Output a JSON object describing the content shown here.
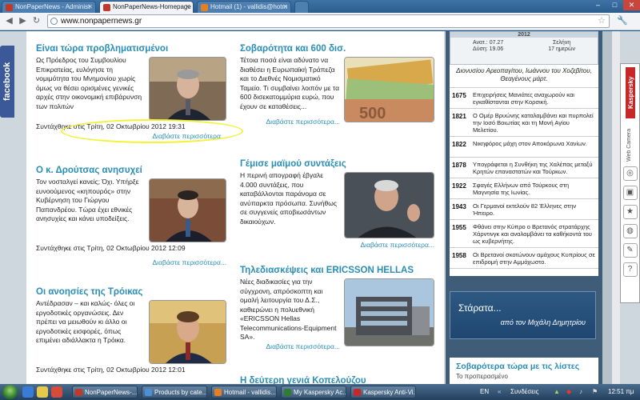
{
  "browser": {
    "tabs": [
      {
        "label": "NonPaperNews - Administ",
        "active": false,
        "favicon_color": "#c0392b"
      },
      {
        "label": "NonPaperNews-Homepage",
        "active": true,
        "favicon_color": "#c0392b"
      },
      {
        "label": "Hotmail (1) - vallidis@hotm",
        "active": false,
        "favicon_color": "#e67e22"
      }
    ],
    "url": "www.nonpapernews.gr",
    "window_controls": [
      "–",
      "□",
      "✕"
    ]
  },
  "facebook_tab": "facebook",
  "articles": [
    {
      "title": "Είναι τώρα προβληματισμένοι",
      "body": "Ως Πρόεδρος του Συμβουλίου Επικρατείας, ευλόγησε τη νομιμότητα του Μνημονίου χωρίς όμως να θέσει ορισμένες γενικές αρχές στην οικονομική επιβάρυνση των πολιτών",
      "date": "Συντάχθηκε στις Τρίτη, 02 Οκτωβρίου 2012 19:31",
      "more": "Διαβάστε περισσότερα..."
    },
    {
      "title": "Σοβαρότητα και 600 δισ.",
      "body": "Τέτοια ποσά είναι αδύνατο να διαθέσει η Ευρωπαϊκή Τράπεζα και το Διεθνές Νομισματικό Ταμείο. Τι συμβαίνει λοιπόν με τα 600 δισεκατομμύρια ευρώ, που έχουν σε καταθέσεις...",
      "date": "",
      "more": "Διαβάστε περισσότερα..."
    },
    {
      "title": "Ο κ. Δρούτσας ανησυχεί",
      "body": "Τον νοσταλγεί κανείς; Όχι. Υπήρξε ευνοούμενος «κηπουρός» στην Κυβέρνηση του Γιώργου Παπανδρέου. Τώρα έχει εθνικές ανησυχίες και κάνει υποδείξεις.",
      "date": "Συντάχθηκε στις Τρίτη, 02 Οκτωβρίου 2012 12:09",
      "more": "Διαβάστε περισσότερα..."
    },
    {
      "title": "Γέμισε μαϊμού συντάξεις",
      "body": "Η περινή απογραφή έβγαλε 4.000 συντάξεις, που καταβάλλονται παράνομα σε ανύπαρκτα πρόσωπα. Συνήθως σε συγγενείς αποβιωσάντων δικαιούχων.",
      "date": "",
      "more": "Διαβάστε περισσότερα..."
    },
    {
      "title": "Οι ανοησίες της Τρόικας",
      "body": "Αντέδρασαν – και καλώς- όλες οι εργοδοτικές οργανώσεις. Δεν πρέπει να μειωθούν κι άλλο οι εργοδοτικές εισφορές, όπως επιμένει αδιάλλακτα η Τρόικα.",
      "date": "Συντάχθηκε στις Τρίτη, 02 Οκτωβρίου 2012 12:01",
      "more": ""
    },
    {
      "title": "Τηλεδιασκέψεις και ERICSSON HELLAS",
      "body": "Νέες διαδικασίες για την σύγχρονη, απρόσκοπτη και ομαλή λειτουργία του Δ.Σ., καθιερώνει η πολυεθνική «ERICSSON Hellas Telecommunications-Equipment SA».",
      "date": "",
      "more": "Διαβάστε περισσότερα..."
    },
    {
      "title": "Η δεύτερη γενιά Κοπελούζου",
      "body": "",
      "date": "",
      "more": ""
    }
  ],
  "sidebar": {
    "calendar": {
      "year": "2012",
      "sunrise": "Ανατ.: 07.27",
      "sunset": "Δύση: 19.06",
      "moon": "Σελήνη",
      "moon_age": "17 ημερών"
    },
    "saints": "Διονυσίου Αρεοπαγίτου, Ιωάννου του Χοζεβίτου, Θεαγένους μάρτ.",
    "history": [
      {
        "year": "1675",
        "event": "Επιχειρήσεις Μανιάτες αναχωρούν και εγκαθίστανται στην Κορσική."
      },
      {
        "year": "1821",
        "event": "Ο Ομέρ Βρυώνης καταλαμβάνει και πυρπολεί την Ιοσό Βοιωτίας και τη Μονή Αγίου Μελετίου."
      },
      {
        "year": "1822",
        "event": "Νικηφόρος μάχη στον Αποκόρωνα Χανίων."
      },
      {
        "year": "1878",
        "event": "Υπογράφεται η Συνθήκη της Χαλέπας μεταξύ Κρητών επαναστατών και Τούρκων."
      },
      {
        "year": "1922",
        "event": "Σφαγές Ελλήνων από Τούρκους στη Μαγνησία της Ιωνίας."
      },
      {
        "year": "1943",
        "event": "Οι Γερμανοί εκτελούν 82 Έλληνες στην Ήπειρο."
      },
      {
        "year": "1955",
        "event": "Φθάνει στην Κύπρο ο Βρετανός στρατάρχης Χάρντινγκ και αναλαμβάνει τα καθήκοντά του ως κυβερνήτης."
      },
      {
        "year": "1958",
        "event": "Οι Βρετανοί σκοτώνουν αμάχους Κυπρίους σε επιδρομή στην Αμμόχωστο."
      }
    ],
    "starata_title": "Στάρατα...",
    "starata_author": "από τον Μιχάλη Δημητρίου",
    "lists_title": "Σοβαρότερα τώρα με τις λίστες",
    "lists_sub": "Το προπερασμένο"
  },
  "kaspersky": {
    "label": "Kaspersky",
    "webcam": "Web Camera"
  },
  "taskbar": {
    "tasks": [
      {
        "label": "NonPaperNews-...",
        "color": "#c0392b"
      },
      {
        "label": "Products by cate...",
        "color": "#4a90d9"
      },
      {
        "label": "Hotmail - vallidis...",
        "color": "#e67e22"
      },
      {
        "label": "My Kaspersky Ac...",
        "color": "#2e7d32"
      },
      {
        "label": "Kaspersky Anti-Vi...",
        "color": "#c62828"
      }
    ],
    "lang": "EN",
    "connections": "Συνδέσεις",
    "clock": "12:51 πμ"
  }
}
